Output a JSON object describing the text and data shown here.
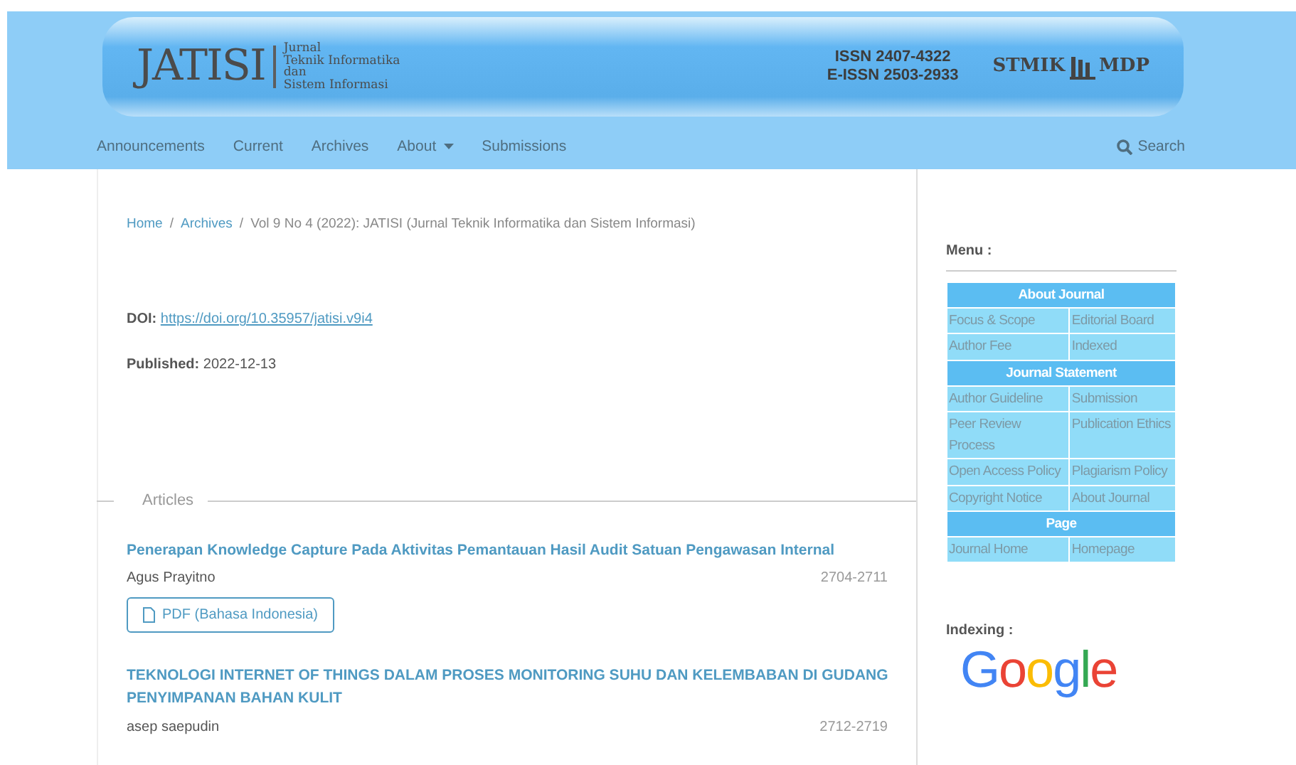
{
  "header": {
    "logo": "JATISI",
    "journal_name": [
      "Jurnal",
      "Teknik Informatika",
      "dan",
      "Sistem Informasi"
    ],
    "issn": "ISSN 2407-4322",
    "eissn": "E-ISSN 2503-2933",
    "publisher_logo": [
      "STMIK",
      "MDP"
    ]
  },
  "nav": {
    "items": [
      {
        "label": "Announcements",
        "dropdown": false
      },
      {
        "label": "Current",
        "dropdown": false
      },
      {
        "label": "Archives",
        "dropdown": false
      },
      {
        "label": "About",
        "dropdown": true
      },
      {
        "label": "Submissions",
        "dropdown": false
      }
    ],
    "search": "Search"
  },
  "breadcrumb": {
    "separator": "/",
    "items": [
      "Home",
      "Archives",
      "Vol 9 No 4 (2022): JATISI (Jurnal Teknik Informatika dan Sistem Informasi)"
    ]
  },
  "doi": {
    "label": "DOI:",
    "link": "https://doi.org/10.35957/jatisi.v9i4"
  },
  "published": {
    "label": "Published:",
    "value": "2022-12-13"
  },
  "section_title": "Articles",
  "articles": [
    {
      "title": "Penerapan Knowledge Capture Pada Aktivitas Pemantauan Hasil Audit Satuan Pengawasan Internal",
      "authors": "Agus Prayitno",
      "pages": "2704-2711",
      "galley": "PDF (Bahasa Indonesia)"
    },
    {
      "title": "TEKNOLOGI INTERNET OF THINGS DALAM PROSES MONITORING SUHU DAN KELEMBABAN DI GUDANG PENYIMPANAN BAHAN KULIT",
      "authors": "asep saepudin",
      "pages": "2712-2719"
    }
  ],
  "sidebar": {
    "menu_title": "Menu :",
    "menu": [
      {
        "kind": "heading",
        "label": "About Journal"
      },
      {
        "kind": "row",
        "cells": [
          "Focus & Scope",
          "Editorial Board"
        ]
      },
      {
        "kind": "row",
        "cells": [
          "Author Fee",
          "Indexed"
        ]
      },
      {
        "kind": "heading",
        "label": "Journal Statement"
      },
      {
        "kind": "row",
        "cells": [
          "Author Guideline",
          "Submission"
        ]
      },
      {
        "kind": "row",
        "cells": [
          "Peer Review Process",
          "Publication Ethics"
        ]
      },
      {
        "kind": "row",
        "cells": [
          "Open Access Policy",
          "Plagiarism Policy"
        ]
      },
      {
        "kind": "row",
        "cells": [
          "Copyright Notice",
          "About Journal"
        ]
      },
      {
        "kind": "heading",
        "label": "Page"
      },
      {
        "kind": "row",
        "cells": [
          "Journal Home",
          "Homepage"
        ]
      }
    ],
    "indexing_title": "Indexing :",
    "indexing_logo": "Google"
  }
}
